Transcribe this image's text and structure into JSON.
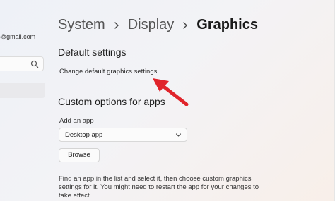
{
  "sidebar": {
    "account_email": "@gmail.com",
    "search_icon": "search-icon"
  },
  "breadcrumb": {
    "items": [
      "System",
      "Display",
      "Graphics"
    ]
  },
  "default_settings": {
    "title": "Default settings",
    "link": "Change default graphics settings"
  },
  "custom_options": {
    "title": "Custom options for apps",
    "add_label": "Add an app",
    "dropdown_value": "Desktop app",
    "browse_label": "Browse",
    "description": "Find an app in the list and select it, then choose custom graphics settings for it. You might need to restart the app for your changes to take effect."
  },
  "colors": {
    "annotation_arrow": "#e0242b"
  }
}
